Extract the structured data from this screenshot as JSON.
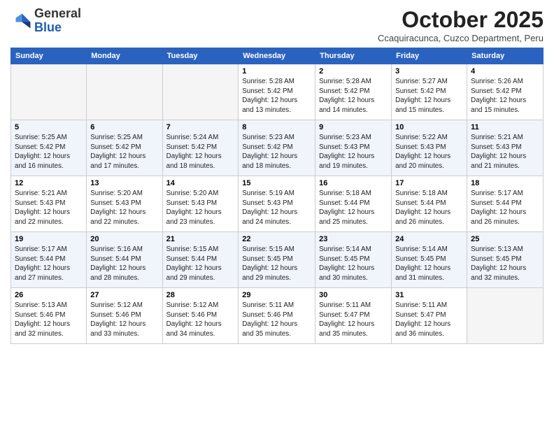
{
  "header": {
    "logo_line1": "General",
    "logo_line2": "Blue",
    "month": "October 2025",
    "location": "Ccaquiracunca, Cuzco Department, Peru"
  },
  "weekdays": [
    "Sunday",
    "Monday",
    "Tuesday",
    "Wednesday",
    "Thursday",
    "Friday",
    "Saturday"
  ],
  "weeks": [
    [
      {
        "day": "",
        "info": ""
      },
      {
        "day": "",
        "info": ""
      },
      {
        "day": "",
        "info": ""
      },
      {
        "day": "1",
        "info": "Sunrise: 5:28 AM\nSunset: 5:42 PM\nDaylight: 12 hours\nand 13 minutes."
      },
      {
        "day": "2",
        "info": "Sunrise: 5:28 AM\nSunset: 5:42 PM\nDaylight: 12 hours\nand 14 minutes."
      },
      {
        "day": "3",
        "info": "Sunrise: 5:27 AM\nSunset: 5:42 PM\nDaylight: 12 hours\nand 15 minutes."
      },
      {
        "day": "4",
        "info": "Sunrise: 5:26 AM\nSunset: 5:42 PM\nDaylight: 12 hours\nand 15 minutes."
      }
    ],
    [
      {
        "day": "5",
        "info": "Sunrise: 5:25 AM\nSunset: 5:42 PM\nDaylight: 12 hours\nand 16 minutes."
      },
      {
        "day": "6",
        "info": "Sunrise: 5:25 AM\nSunset: 5:42 PM\nDaylight: 12 hours\nand 17 minutes."
      },
      {
        "day": "7",
        "info": "Sunrise: 5:24 AM\nSunset: 5:42 PM\nDaylight: 12 hours\nand 18 minutes."
      },
      {
        "day": "8",
        "info": "Sunrise: 5:23 AM\nSunset: 5:42 PM\nDaylight: 12 hours\nand 18 minutes."
      },
      {
        "day": "9",
        "info": "Sunrise: 5:23 AM\nSunset: 5:43 PM\nDaylight: 12 hours\nand 19 minutes."
      },
      {
        "day": "10",
        "info": "Sunrise: 5:22 AM\nSunset: 5:43 PM\nDaylight: 12 hours\nand 20 minutes."
      },
      {
        "day": "11",
        "info": "Sunrise: 5:21 AM\nSunset: 5:43 PM\nDaylight: 12 hours\nand 21 minutes."
      }
    ],
    [
      {
        "day": "12",
        "info": "Sunrise: 5:21 AM\nSunset: 5:43 PM\nDaylight: 12 hours\nand 22 minutes."
      },
      {
        "day": "13",
        "info": "Sunrise: 5:20 AM\nSunset: 5:43 PM\nDaylight: 12 hours\nand 22 minutes."
      },
      {
        "day": "14",
        "info": "Sunrise: 5:20 AM\nSunset: 5:43 PM\nDaylight: 12 hours\nand 23 minutes."
      },
      {
        "day": "15",
        "info": "Sunrise: 5:19 AM\nSunset: 5:43 PM\nDaylight: 12 hours\nand 24 minutes."
      },
      {
        "day": "16",
        "info": "Sunrise: 5:18 AM\nSunset: 5:44 PM\nDaylight: 12 hours\nand 25 minutes."
      },
      {
        "day": "17",
        "info": "Sunrise: 5:18 AM\nSunset: 5:44 PM\nDaylight: 12 hours\nand 26 minutes."
      },
      {
        "day": "18",
        "info": "Sunrise: 5:17 AM\nSunset: 5:44 PM\nDaylight: 12 hours\nand 26 minutes."
      }
    ],
    [
      {
        "day": "19",
        "info": "Sunrise: 5:17 AM\nSunset: 5:44 PM\nDaylight: 12 hours\nand 27 minutes."
      },
      {
        "day": "20",
        "info": "Sunrise: 5:16 AM\nSunset: 5:44 PM\nDaylight: 12 hours\nand 28 minutes."
      },
      {
        "day": "21",
        "info": "Sunrise: 5:15 AM\nSunset: 5:44 PM\nDaylight: 12 hours\nand 29 minutes."
      },
      {
        "day": "22",
        "info": "Sunrise: 5:15 AM\nSunset: 5:45 PM\nDaylight: 12 hours\nand 29 minutes."
      },
      {
        "day": "23",
        "info": "Sunrise: 5:14 AM\nSunset: 5:45 PM\nDaylight: 12 hours\nand 30 minutes."
      },
      {
        "day": "24",
        "info": "Sunrise: 5:14 AM\nSunset: 5:45 PM\nDaylight: 12 hours\nand 31 minutes."
      },
      {
        "day": "25",
        "info": "Sunrise: 5:13 AM\nSunset: 5:45 PM\nDaylight: 12 hours\nand 32 minutes."
      }
    ],
    [
      {
        "day": "26",
        "info": "Sunrise: 5:13 AM\nSunset: 5:46 PM\nDaylight: 12 hours\nand 32 minutes."
      },
      {
        "day": "27",
        "info": "Sunrise: 5:12 AM\nSunset: 5:46 PM\nDaylight: 12 hours\nand 33 minutes."
      },
      {
        "day": "28",
        "info": "Sunrise: 5:12 AM\nSunset: 5:46 PM\nDaylight: 12 hours\nand 34 minutes."
      },
      {
        "day": "29",
        "info": "Sunrise: 5:11 AM\nSunset: 5:46 PM\nDaylight: 12 hours\nand 35 minutes."
      },
      {
        "day": "30",
        "info": "Sunrise: 5:11 AM\nSunset: 5:47 PM\nDaylight: 12 hours\nand 35 minutes."
      },
      {
        "day": "31",
        "info": "Sunrise: 5:11 AM\nSunset: 5:47 PM\nDaylight: 12 hours\nand 36 minutes."
      },
      {
        "day": "",
        "info": ""
      }
    ]
  ]
}
